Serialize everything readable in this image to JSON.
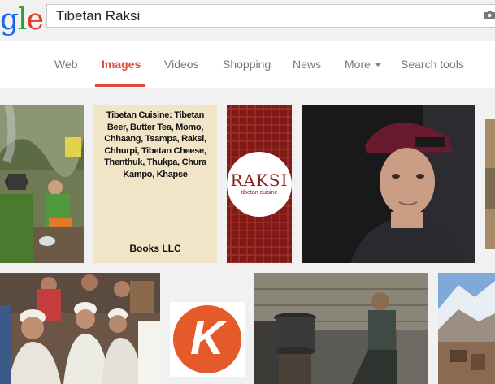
{
  "logo": {
    "part1": "g",
    "part2": "l",
    "part3": "e"
  },
  "search": {
    "query": "Tibetan Raksi"
  },
  "nav": {
    "tabs": [
      {
        "label": "Web"
      },
      {
        "label": "Images"
      },
      {
        "label": "Videos"
      },
      {
        "label": "Shopping"
      },
      {
        "label": "News"
      },
      {
        "label": "More"
      },
      {
        "label": "Search tools"
      }
    ]
  },
  "results": {
    "book_cover": {
      "title": "Tibetan Cuisine: Tibetan Beer, Butter Tea, Momo, Chhaang, Tsampa, Raksi, Chhurpi, Tibetan Cheese, Thenthuk, Thukpa, Chura Kampo, Khapse",
      "publisher": "Books LLC"
    },
    "raksi_logo": {
      "title": "RAKSI",
      "subtitle": "tibetan cuisine"
    },
    "k_logo": {
      "letter": "K"
    }
  },
  "colors": {
    "accent": "#dd4b39",
    "tab_text": "#777777",
    "bar_bg": "#f1f1f1"
  }
}
